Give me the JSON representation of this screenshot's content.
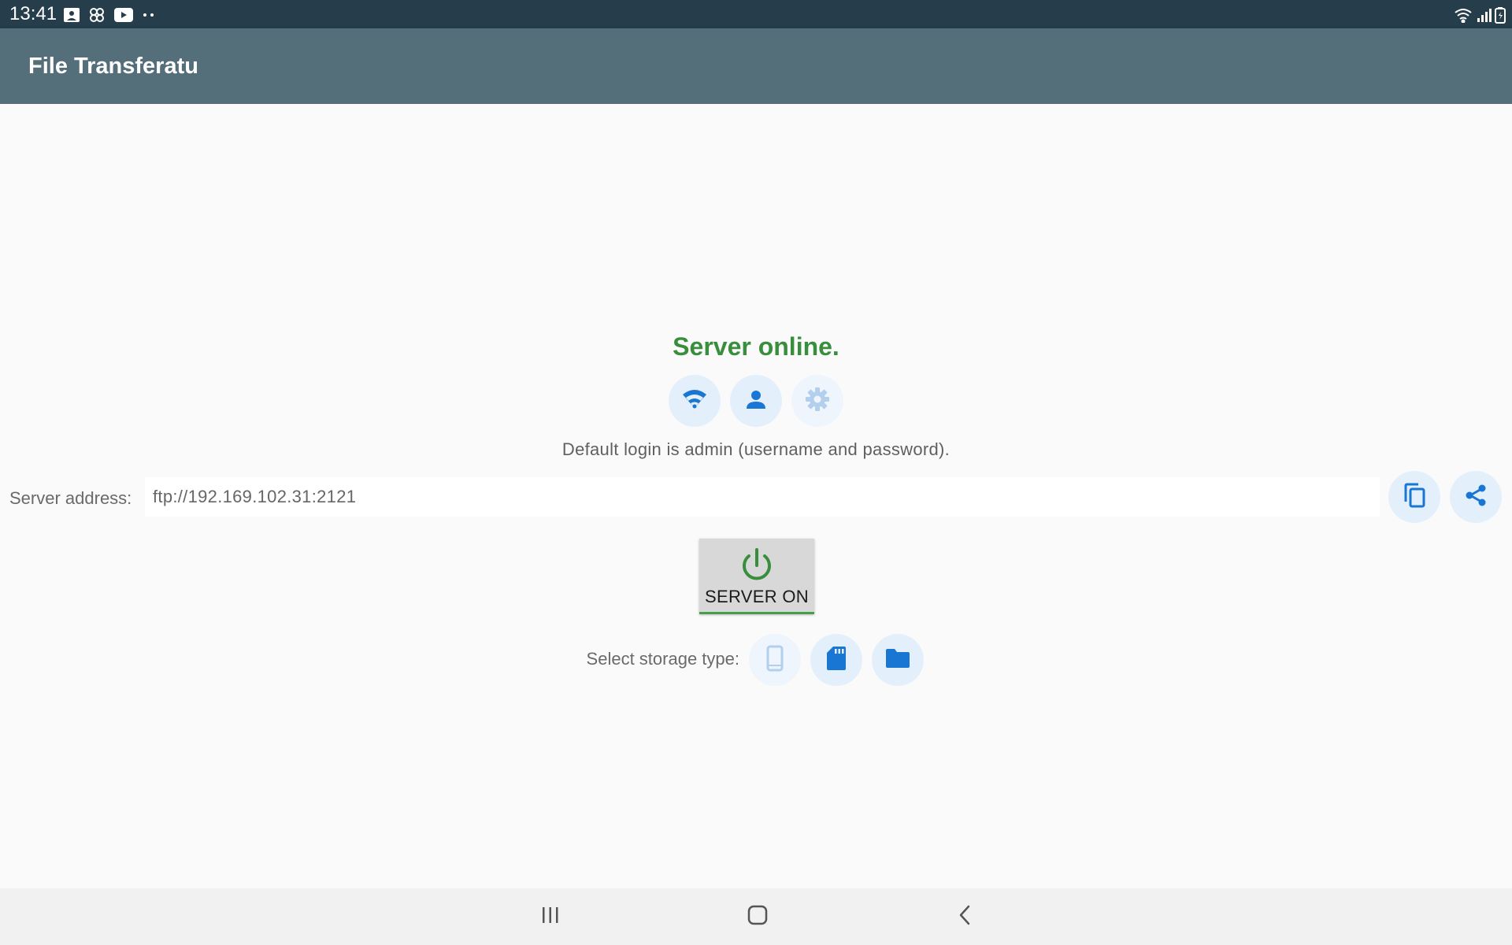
{
  "status_bar": {
    "time": "13:41",
    "left_icons": [
      "image-icon",
      "pinwheel-icon",
      "youtube-icon",
      "more-dots-icon"
    ],
    "right_icons": [
      "wifi-signal-icon",
      "cell-signal-icon",
      "battery-icon"
    ]
  },
  "app_bar": {
    "title": "File Transferatu",
    "background_color": "#546e7a"
  },
  "server": {
    "status": "Server online.",
    "status_color": "#388e3c",
    "action_icons": [
      "wifi-icon",
      "user-icon",
      "settings-gear-icon"
    ],
    "login_hint": "Default login is admin (username and password).",
    "address_label": "Server address:",
    "address_value": "ftp://192.169.102.31:2121",
    "address_actions": [
      "copy-icon",
      "share-icon"
    ],
    "toggle_label": "SERVER ON",
    "toggle_icon": "power-icon"
  },
  "storage": {
    "label": "Select storage type:",
    "options": [
      "phone-icon",
      "sd-card-icon",
      "folder-icon"
    ]
  },
  "nav_bar": {
    "buttons": [
      "recent-apps-icon",
      "home-icon",
      "back-icon"
    ]
  },
  "colors": {
    "accent_blue": "#1976d2",
    "status_green": "#388e3c",
    "status_bar": "#263d4b"
  }
}
